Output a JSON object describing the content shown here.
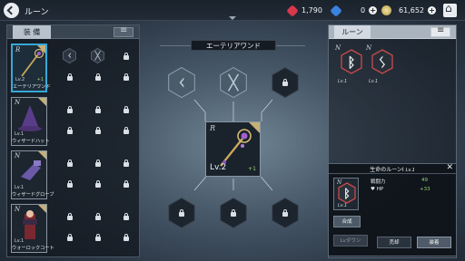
{
  "header": {
    "title": "ルーン",
    "currencies": [
      {
        "icon": "red-gem-icon",
        "value": "1,790",
        "color": "#d8384c"
      },
      {
        "icon": "blue-gem-icon",
        "value": "0",
        "color": "#3a82e0"
      },
      {
        "icon": "gold-coin-icon",
        "value": "61,652",
        "color": "#d8c270"
      }
    ]
  },
  "left_panel": {
    "tab_label": "装 備",
    "equipment": [
      {
        "rank": "R",
        "level": "Lv.2",
        "plus": "+1",
        "name": "エーテリアワンド",
        "selected": true,
        "slots": [
          "rune-kaun",
          "rune-gebo",
          "lock",
          "lock",
          "lock",
          "lock"
        ]
      },
      {
        "rank": "N",
        "level": "Lv.1",
        "plus": "",
        "name": "ウィザードハット",
        "selected": false,
        "slots": [
          "lock",
          "lock",
          "lock",
          "lock",
          "lock",
          "lock"
        ]
      },
      {
        "rank": "N",
        "level": "Lv.1",
        "plus": "",
        "name": "ウィザードグローブ",
        "selected": false,
        "slots": [
          "lock",
          "lock",
          "lock",
          "lock",
          "lock",
          "lock"
        ]
      },
      {
        "rank": "N",
        "level": "Lv.1",
        "plus": "",
        "name": "ウォーロックコート",
        "selected": false,
        "slots": [
          "lock",
          "lock",
          "lock",
          "lock",
          "lock",
          "lock"
        ]
      }
    ]
  },
  "center": {
    "title": "エーテリアワンド",
    "weapon": {
      "rank": "R",
      "level": "Lv.2",
      "plus": "+1"
    },
    "top_slots": [
      "rune-kaun",
      "rune-gebo",
      "lock"
    ],
    "bottom_slots": [
      "lock",
      "lock",
      "lock"
    ]
  },
  "right_panel": {
    "tab_label": "ルーン",
    "runes": [
      {
        "rank": "N",
        "level": "Lv.1",
        "glyph": "ᛒ"
      },
      {
        "rank": "N",
        "level": "Lv.1",
        "glyph": "ᛊ"
      }
    ]
  },
  "detail": {
    "title": "生命のルーンI",
    "title_level": "Lv.1",
    "rune": {
      "rank": "N",
      "level": "Lv.1",
      "glyph": "ᛒ"
    },
    "stats": [
      {
        "label": "戦闘力",
        "value": "49"
      },
      {
        "label": "HP",
        "value": "+33"
      }
    ],
    "compose_label": "合成",
    "lvdown_label": "Lvダウン",
    "sell_label": "売却",
    "equip_label": "装着"
  }
}
